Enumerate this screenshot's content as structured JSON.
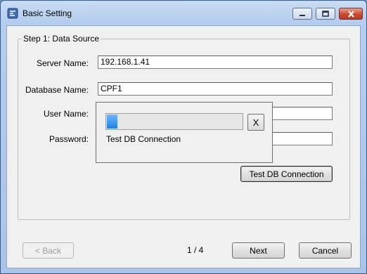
{
  "window": {
    "title": "Basic Setting",
    "app_icon": "app-icon"
  },
  "caption_buttons": {
    "minimize_icon": "minimize-icon",
    "maximize_icon": "maximize-icon",
    "close_icon": "close-icon"
  },
  "group": {
    "legend": "Step 1: Data Source"
  },
  "fields": {
    "server_name": {
      "label": "Server Name:",
      "value": "192.168.1.41"
    },
    "database_name": {
      "label": "Database Name:",
      "value": "CPF1"
    },
    "user_name": {
      "label": "User Name:",
      "value": ""
    },
    "password": {
      "label": "Password:",
      "value": ""
    }
  },
  "test_button": {
    "label": "Test DB Connection"
  },
  "progress_popup": {
    "close_label": "X",
    "status_text": "Test DB Connection",
    "progress_fraction": 0.08
  },
  "footer": {
    "back_label": "< Back",
    "page_indicator": "1 / 4",
    "next_label": "Next",
    "cancel_label": "Cancel"
  },
  "colors": {
    "progress": "#1e7fe0",
    "close_button": "#c94b32"
  }
}
